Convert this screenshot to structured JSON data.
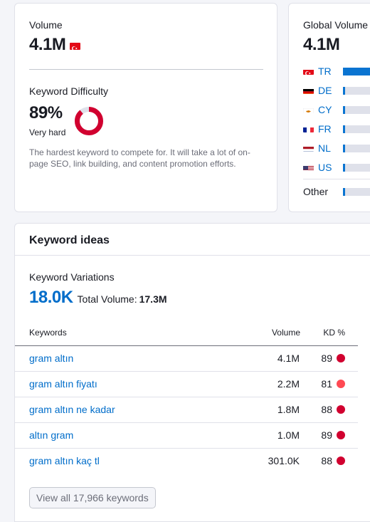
{
  "overview": {
    "volume_label": "Volume",
    "volume_value": "4.1M",
    "kd_label": "Keyword Difficulty",
    "kd_value": "89%",
    "kd_level": "Very hard",
    "kd_percent": 89,
    "kd_description": "The hardest keyword to compete for. It will take a lot of on-page SEO, link building, and content promotion efforts.",
    "kd_color": "#d1002f"
  },
  "global": {
    "label": "Global Volume",
    "value": "4.1M",
    "countries": [
      {
        "code": "TR",
        "flag": "flag-turkey-icon",
        "share": 0.95
      },
      {
        "code": "DE",
        "flag": "flag-germany-icon",
        "share": 0.05
      },
      {
        "code": "CY",
        "flag": "flag-cyprus-icon",
        "share": 0.05
      },
      {
        "code": "FR",
        "flag": "flag-france-icon",
        "share": 0.05
      },
      {
        "code": "NL",
        "flag": "flag-netherlands-icon",
        "share": 0.05
      },
      {
        "code": "US",
        "flag": "flag-usa-icon",
        "share": 0.05
      }
    ],
    "other_label": "Other",
    "other_share": 0.05
  },
  "ideas": {
    "title": "Keyword ideas",
    "variations_label": "Keyword Variations",
    "variations_value": "18.0K",
    "total_volume_label": "Total Volume:",
    "total_volume_value": "17.3M",
    "columns": {
      "keyword": "Keywords",
      "volume": "Volume",
      "kd": "KD %"
    },
    "rows": [
      {
        "keyword": "gram altın",
        "volume": "4.1M",
        "kd": "89",
        "kd_color": "#d1002f"
      },
      {
        "keyword": "gram altın fiyatı",
        "volume": "2.2M",
        "kd": "81",
        "kd_color": "#ff4953"
      },
      {
        "keyword": "gram altın ne kadar",
        "volume": "1.8M",
        "kd": "88",
        "kd_color": "#d1002f"
      },
      {
        "keyword": "altın gram",
        "volume": "1.0M",
        "kd": "89",
        "kd_color": "#d1002f"
      },
      {
        "keyword": "gram altın kaç tl",
        "volume": "301.0K",
        "kd": "88",
        "kd_color": "#d1002f"
      }
    ],
    "view_all_label": "View all 17,966 keywords"
  },
  "colors": {
    "link": "#006dca",
    "bar": "#0a74d1",
    "bar_bg": "#dfe1ea"
  }
}
